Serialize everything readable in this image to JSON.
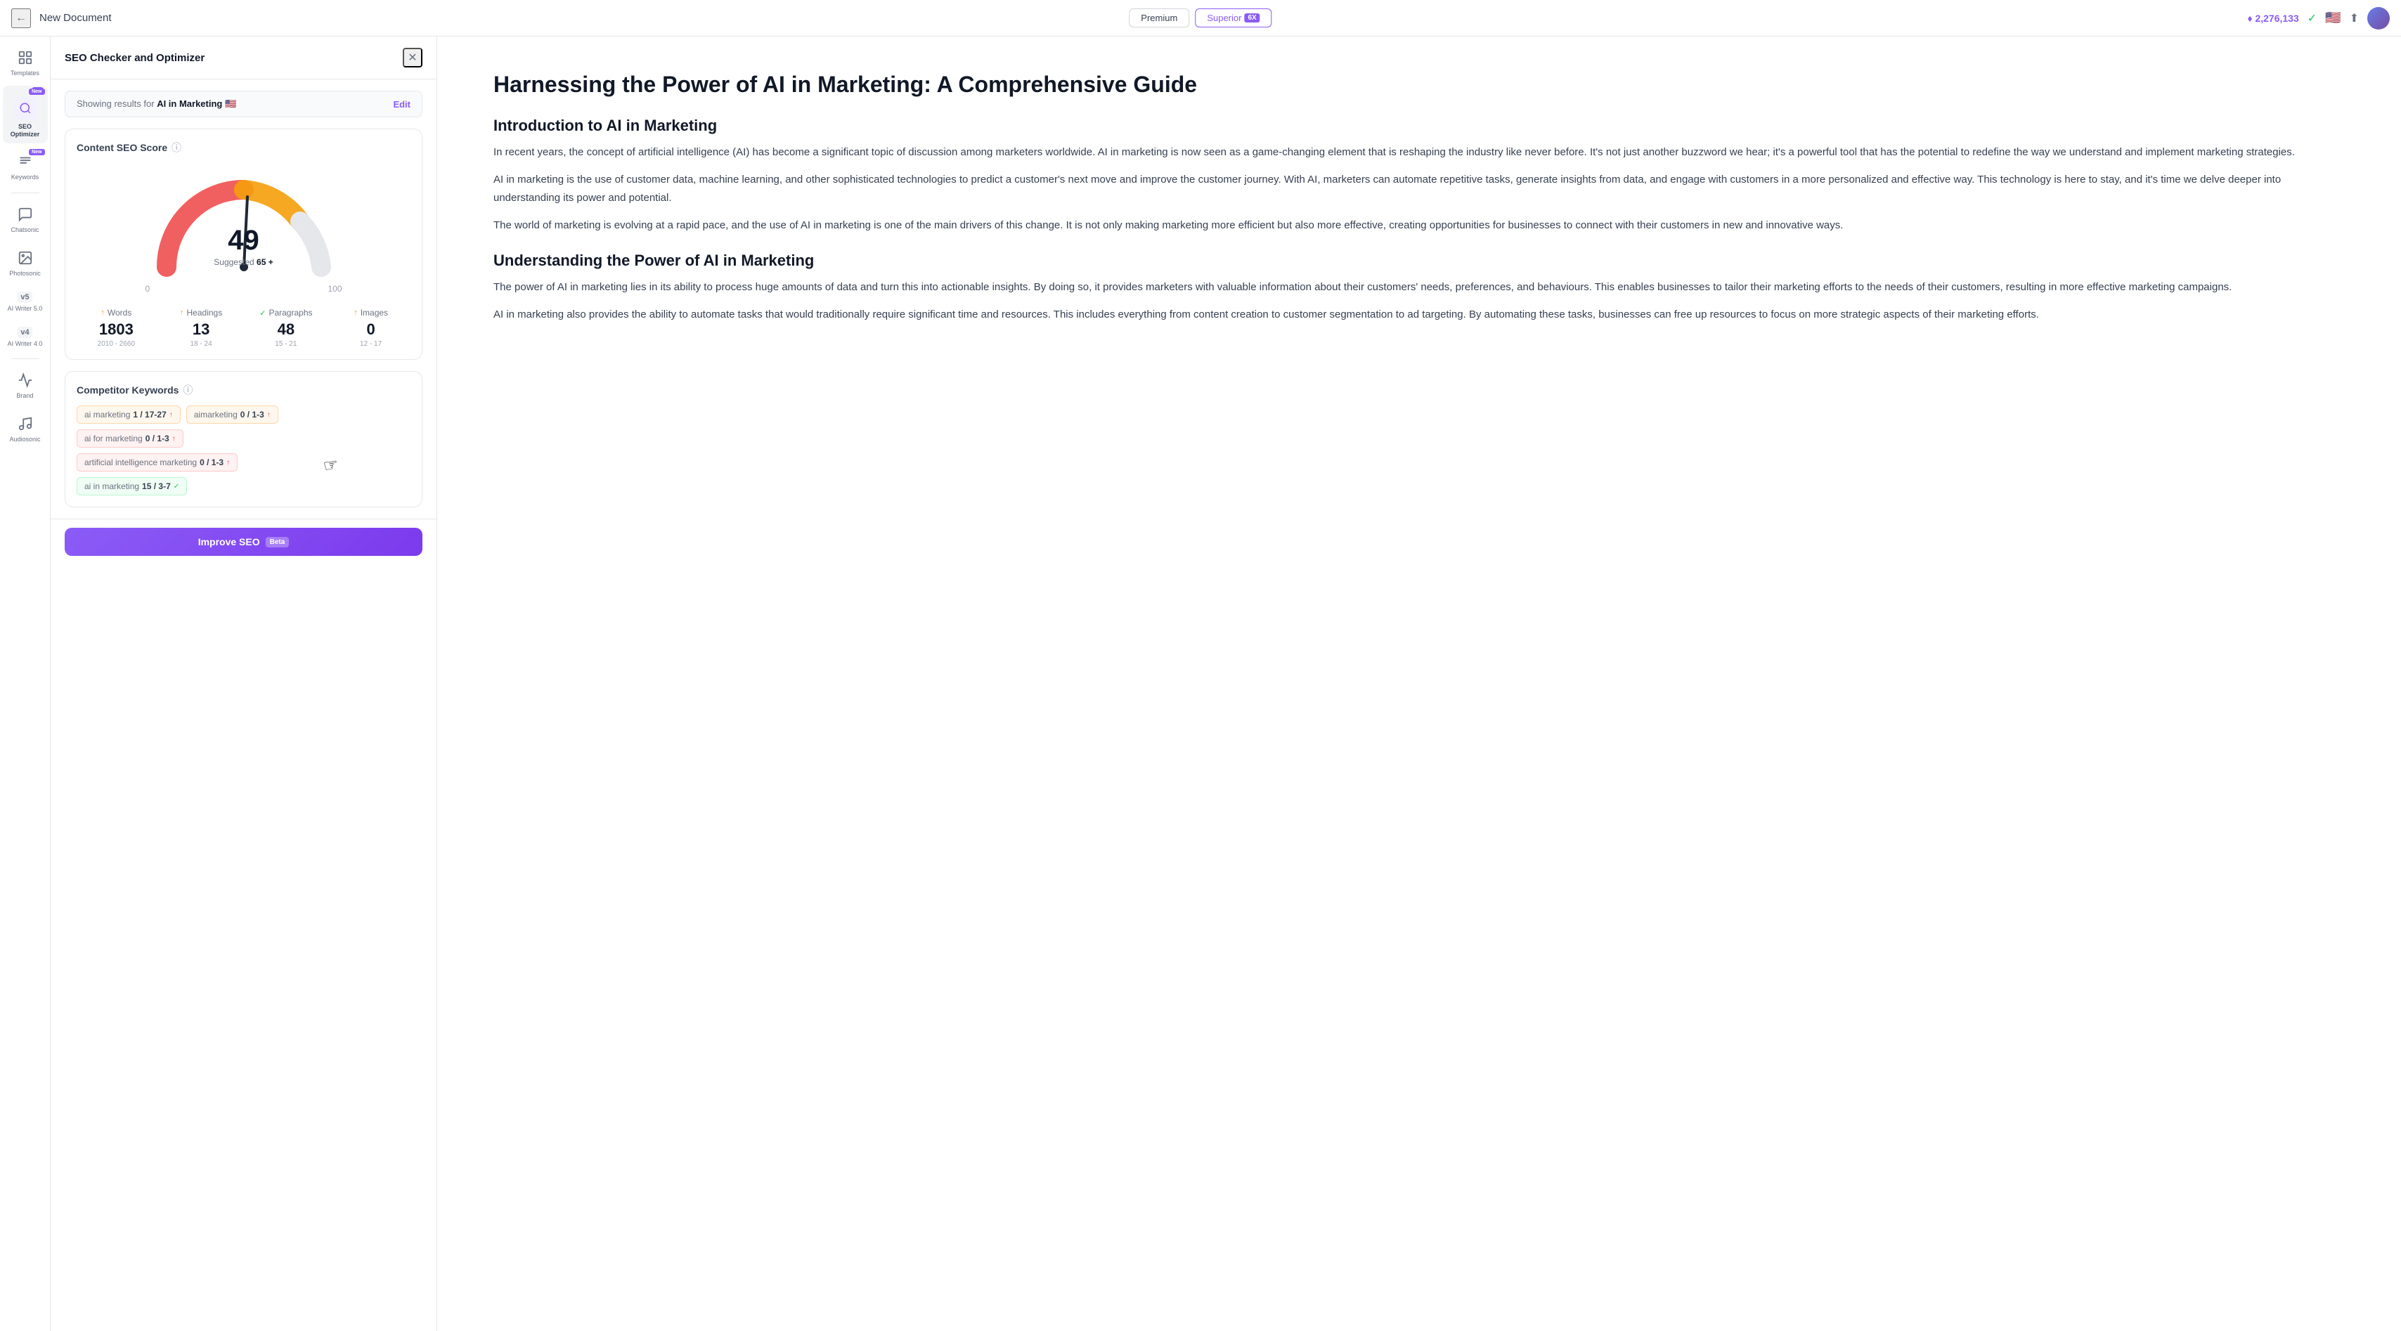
{
  "topbar": {
    "back_icon": "←",
    "title": "New Document",
    "btn_premium": "Premium",
    "btn_superior": "Superior",
    "superior_badge": "6X",
    "credits": "♦ 2,276,133",
    "check": "✓",
    "flag": "🇺🇸",
    "share_icon": "⬆",
    "avatar_alt": "User Avatar"
  },
  "sidebar": {
    "items": [
      {
        "id": "templates",
        "icon": "⊞",
        "label": "Templates",
        "active": false,
        "badge": null
      },
      {
        "id": "seo-optimizer",
        "icon": "49",
        "label": "SEO\nOptimizer",
        "active": true,
        "badge": "New"
      },
      {
        "id": "keywords",
        "icon": "K",
        "label": "Keywords",
        "active": false,
        "badge": "New"
      },
      {
        "id": "chatsonic",
        "icon": "CS",
        "label": "Chatsonic",
        "active": false,
        "badge": null
      },
      {
        "id": "photosonic",
        "icon": "PS",
        "label": "Photosonic",
        "active": false,
        "badge": null
      },
      {
        "id": "ai-writer-5",
        "icon": "v5",
        "label": "AI Writer 5.0",
        "active": false,
        "badge": null
      },
      {
        "id": "ai-writer-4",
        "icon": "v4",
        "label": "AI Writer 4.0",
        "active": false,
        "badge": null
      },
      {
        "id": "brand",
        "icon": "📢",
        "label": "Brand",
        "active": false,
        "badge": null
      },
      {
        "id": "audiosonic",
        "icon": "🎵",
        "label": "Audiosonic",
        "active": false,
        "badge": null
      }
    ]
  },
  "seo_panel": {
    "title": "SEO Checker and Optimizer",
    "close_icon": "✕",
    "results_prefix": "Showing results for",
    "results_keyword": "AI in Marketing",
    "results_flag": "🇺🇸",
    "edit_label": "Edit",
    "score_section": {
      "title": "Content SEO Score",
      "info_icon": "ⓘ",
      "score": "49",
      "suggested_label": "Suggested",
      "suggested_value": "65 +",
      "gauge_min": "0",
      "gauge_max": "100"
    },
    "stats": [
      {
        "icon": "↑",
        "icon_color": "orange",
        "label": "Words",
        "value": "1803",
        "range": "2010 - 2660"
      },
      {
        "icon": "↑",
        "icon_color": "orange",
        "label": "Headings",
        "value": "13",
        "range": "18 - 24"
      },
      {
        "icon": "✓",
        "icon_color": "green",
        "label": "Paragraphs",
        "value": "48",
        "range": "15 - 21"
      },
      {
        "icon": "↑",
        "icon_color": "orange",
        "label": "Images",
        "value": "0",
        "range": "12 - 17"
      }
    ],
    "competitor_keywords": {
      "title": "Competitor Keywords",
      "info_icon": "ⓘ",
      "keywords": [
        {
          "name": "ai marketing",
          "count": "1 / 17-27",
          "arrow": "↑",
          "arrow_type": "up",
          "color": "orange"
        },
        {
          "name": "aimarketing",
          "count": "0 / 1-3",
          "arrow": "↑",
          "arrow_type": "up",
          "color": "orange"
        },
        {
          "name": "ai for marketing",
          "count": "0 / 1-3",
          "arrow": "↑",
          "arrow_type": "up",
          "color": "red"
        },
        {
          "name": "artificial intelligence marketing",
          "count": "0 / 1-3",
          "arrow": "↑",
          "arrow_type": "up",
          "color": "red"
        },
        {
          "name": "ai in marketing",
          "count": "15 / 3-7",
          "arrow": "✓",
          "arrow_type": "check",
          "color": "green"
        }
      ]
    },
    "improve_btn": "Improve SEO",
    "beta_badge": "Beta"
  },
  "article": {
    "title": "Harnessing the Power of AI in Marketing: A Comprehensive Guide",
    "sections": [
      {
        "heading": "Introduction to AI in Marketing",
        "paragraphs": [
          "In recent years, the concept of artificial intelligence (AI) has become a significant topic of discussion among marketers worldwide. AI in marketing is now seen as a game-changing element that is reshaping the industry like never before. It's not just another buzzword we hear; it's a powerful tool that has the potential to redefine the way we understand and implement marketing strategies.",
          "AI in marketing is the use of customer data, machine learning, and other sophisticated technologies to predict a customer's next move and improve the customer journey. With AI, marketers can automate repetitive tasks, generate insights from data, and engage with customers in a more personalized and effective way. This technology is here to stay, and it's time we delve deeper into understanding its power and potential.",
          "The world of marketing is evolving at a rapid pace, and the use of AI in marketing is one of the main drivers of this change. It is not only making marketing more efficient but also more effective, creating opportunities for businesses to connect with their customers in new and innovative ways."
        ]
      },
      {
        "heading": "Understanding the Power of AI in Marketing",
        "paragraphs": [
          "The power of AI in marketing lies in its ability to process huge amounts of data and turn this into actionable insights. By doing so, it provides marketers with valuable information about their customers' needs, preferences, and behaviours. This enables businesses to tailor their marketing efforts to the needs of their customers, resulting in more effective marketing campaigns.",
          "AI in marketing also provides the ability to automate tasks that would traditionally require significant time and resources. This includes everything from content creation to customer segmentation to ad targeting. By automating these tasks, businesses can free up resources to focus on more strategic aspects of their marketing efforts."
        ]
      }
    ]
  }
}
